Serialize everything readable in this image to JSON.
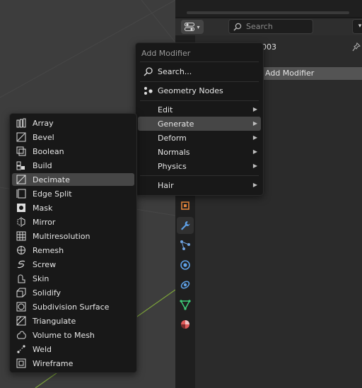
{
  "properties_header": {
    "search_placeholder": "Search",
    "object_name": "003",
    "add_modifier_button": "Add Modifier"
  },
  "add_modifier_menu": {
    "title": "Add Modifier",
    "items": [
      {
        "label": "Search...",
        "icon": "search-icon",
        "submenu": false
      },
      {
        "label": "Geometry Nodes",
        "icon": "geometry-nodes-icon",
        "submenu": false
      },
      {
        "label": "Edit",
        "submenu": true
      },
      {
        "label": "Generate",
        "submenu": true,
        "highlighted": true
      },
      {
        "label": "Deform",
        "submenu": true
      },
      {
        "label": "Normals",
        "submenu": true
      },
      {
        "label": "Physics",
        "submenu": true
      },
      {
        "label": "Hair",
        "submenu": true
      }
    ]
  },
  "generate_menu": {
    "items": [
      {
        "label": "Array",
        "icon": "array-icon"
      },
      {
        "label": "Bevel",
        "icon": "bevel-icon"
      },
      {
        "label": "Boolean",
        "icon": "boolean-icon"
      },
      {
        "label": "Build",
        "icon": "build-icon"
      },
      {
        "label": "Decimate",
        "icon": "decimate-icon",
        "highlighted": true
      },
      {
        "label": "Edge Split",
        "icon": "edge-split-icon"
      },
      {
        "label": "Mask",
        "icon": "mask-icon"
      },
      {
        "label": "Mirror",
        "icon": "mirror-icon"
      },
      {
        "label": "Multiresolution",
        "icon": "multiresolution-icon"
      },
      {
        "label": "Remesh",
        "icon": "remesh-icon"
      },
      {
        "label": "Screw",
        "icon": "screw-icon"
      },
      {
        "label": "Skin",
        "icon": "skin-icon"
      },
      {
        "label": "Solidify",
        "icon": "solidify-icon"
      },
      {
        "label": "Subdivision Surface",
        "icon": "subdivision-surface-icon"
      },
      {
        "label": "Triangulate",
        "icon": "triangulate-icon"
      },
      {
        "label": "Volume to Mesh",
        "icon": "volume-to-mesh-icon"
      },
      {
        "label": "Weld",
        "icon": "weld-icon"
      },
      {
        "label": "Wireframe",
        "icon": "wireframe-icon"
      }
    ]
  },
  "property_tabs": [
    {
      "icon": "object-properties-icon",
      "color": "#e0843c"
    },
    {
      "icon": "modifier-properties-icon",
      "color": "#5ea0e6",
      "active": true
    },
    {
      "icon": "particles-properties-icon",
      "color": "#6fa3e0"
    },
    {
      "icon": "physics-properties-icon",
      "color": "#5ea0e6"
    },
    {
      "icon": "constraints-properties-icon",
      "color": "#5ea0e6"
    },
    {
      "icon": "object-data-properties-icon",
      "color": "#3fcf7a"
    },
    {
      "icon": "material-properties-icon",
      "color": "#e05a5a"
    }
  ],
  "colors": {
    "menu_bg": "#181818",
    "highlight": "#464646",
    "text": "#e6e6e6",
    "viewport_bg": "#3d3d3d"
  }
}
